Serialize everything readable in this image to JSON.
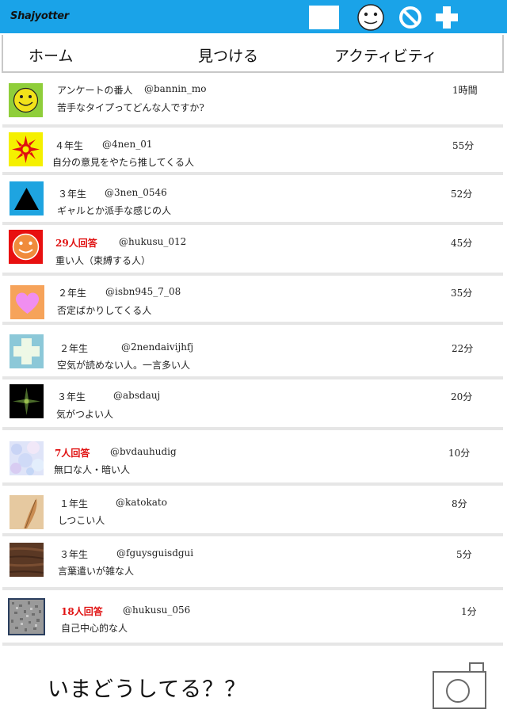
{
  "app": {
    "title": "Shajyotter"
  },
  "header_icons": [
    "mail-icon",
    "smiley-face-icon",
    "block-icon",
    "plus-icon"
  ],
  "nav": {
    "tabs": [
      "ホーム",
      "見つける",
      "アクティビティ"
    ]
  },
  "feed": [
    {
      "avatar": "green-smiley",
      "meta": "アンケートの番人",
      "meta_red": false,
      "handle": "@bannin_mo",
      "time": "1時間",
      "text": "苦手なタイプってどんな人ですか?"
    },
    {
      "avatar": "red-flower-yellow",
      "meta": "４年生",
      "meta_red": false,
      "handle": "@4nen_01",
      "time": "55分",
      "text": "自分の意見をやたら推してくる人"
    },
    {
      "avatar": "black-triangle-blue",
      "meta": "３年生",
      "meta_red": false,
      "handle": "@3nen_0546",
      "time": "52分",
      "text": "ギャルとか派手な感じの人"
    },
    {
      "avatar": "orange-smiley-red",
      "meta": "29人回答",
      "meta_red": true,
      "handle": "@hukusu_012",
      "time": "45分",
      "text": "重い人（束縛する人）"
    },
    {
      "avatar": "pink-heart-orange",
      "meta": "２年生",
      "meta_red": false,
      "handle": "@isbn945_7_08",
      "time": "35分",
      "text": "否定ばかりしてくる人"
    },
    {
      "avatar": "white-cross-lightblue",
      "meta": "２年生",
      "meta_red": false,
      "handle": "@2nendaivijhfj",
      "time": "22分",
      "text": "空気が読めない人。一言多い人"
    },
    {
      "avatar": "green-star-black",
      "meta": "３年生",
      "meta_red": false,
      "handle": "@absdauj",
      "time": "20分",
      "text": "気がつよい人"
    },
    {
      "avatar": "pastel-texture",
      "meta": "7人回答",
      "meta_red": true,
      "handle": "@bvdauhudig",
      "time": "10分",
      "text": "無口な人・暗い人"
    },
    {
      "avatar": "feather-texture",
      "meta": "１年生",
      "meta_red": false,
      "handle": "@katokato",
      "time": "8分",
      "text": "しつこい人"
    },
    {
      "avatar": "wood-texture",
      "meta": "３年生",
      "meta_red": false,
      "handle": "@fguysguisdgui",
      "time": "5分",
      "text": "言葉遣いが雑な人"
    },
    {
      "avatar": "gray-noise-texture",
      "meta": "18人回答",
      "meta_red": true,
      "handle": "@hukusu_056",
      "time": "1分",
      "text": "自己中心的な人"
    }
  ],
  "composer": {
    "prompt": "いまどうしてる？？",
    "camera_icon": "camera-icon"
  },
  "colors": {
    "topbar": "#1aa3e8",
    "answer_count": "#e01010"
  }
}
